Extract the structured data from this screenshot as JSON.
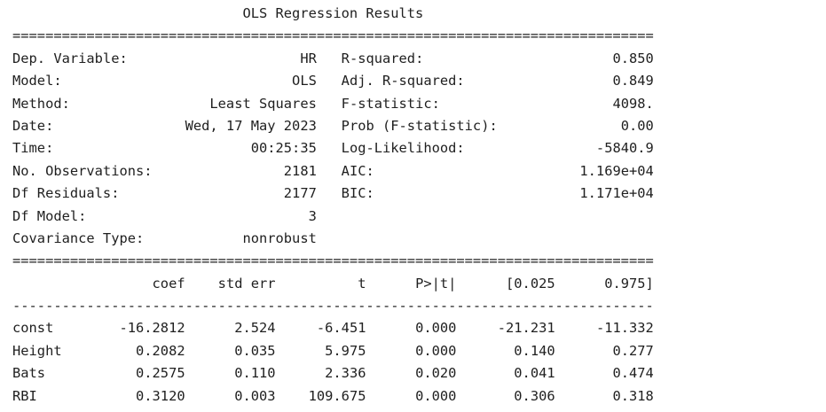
{
  "title": "OLS Regression Results",
  "separator_double": "==============================================================================",
  "separator_single": "------------------------------------------------------------------------------",
  "summary": {
    "left": [
      {
        "label": "Dep. Variable:",
        "value": "HR"
      },
      {
        "label": "Model:",
        "value": "OLS"
      },
      {
        "label": "Method:",
        "value": "Least Squares"
      },
      {
        "label": "Date:",
        "value": "Wed, 17 May 2023"
      },
      {
        "label": "Time:",
        "value": "00:25:35"
      },
      {
        "label": "No. Observations:",
        "value": "2181"
      },
      {
        "label": "Df Residuals:",
        "value": "2177"
      },
      {
        "label": "Df Model:",
        "value": "3"
      },
      {
        "label": "Covariance Type:",
        "value": "nonrobust"
      }
    ],
    "right": [
      {
        "label": "R-squared:",
        "value": "0.850"
      },
      {
        "label": "Adj. R-squared:",
        "value": "0.849"
      },
      {
        "label": "F-statistic:",
        "value": "4098."
      },
      {
        "label": "Prob (F-statistic):",
        "value": "0.00"
      },
      {
        "label": "Log-Likelihood:",
        "value": "-5840.9"
      },
      {
        "label": "AIC:",
        "value": "1.169e+04"
      },
      {
        "label": "BIC:",
        "value": "1.171e+04"
      }
    ]
  },
  "coef_table": {
    "headers": [
      "",
      "coef",
      "std err",
      "t",
      "P>|t|",
      "[0.025",
      "0.975]"
    ],
    "rows": [
      [
        "const",
        "-16.2812",
        "2.524",
        "-6.451",
        "0.000",
        "-21.231",
        "-11.332"
      ],
      [
        "Height",
        "0.2082",
        "0.035",
        "5.975",
        "0.000",
        "0.140",
        "0.277"
      ],
      [
        "Bats",
        "0.2575",
        "0.110",
        "2.336",
        "0.020",
        "0.041",
        "0.474"
      ],
      [
        "RBI",
        "0.3120",
        "0.003",
        "109.675",
        "0.000",
        "0.306",
        "0.318"
      ]
    ]
  }
}
